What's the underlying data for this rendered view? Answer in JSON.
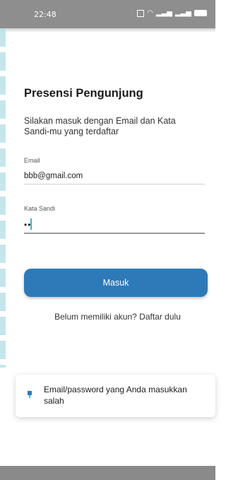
{
  "status": {
    "time": "22:48"
  },
  "title": "Presensi Pengunjung",
  "subtitle": "Silakan masuk dengan Email dan Kata Sandi-mu yang terdaftar",
  "email": {
    "label": "Email",
    "value": "bbb@gmail.com"
  },
  "password": {
    "label": "Kata Sandi",
    "masked": "••"
  },
  "login_button": "Masuk",
  "register_link": "Belum memiliki akun? Daftar dulu",
  "toast": {
    "message": "Email/password yang Anda masukkan salah"
  },
  "colors": {
    "accent": "#2e7ab8",
    "caret": "#34b7c9",
    "statusbar": "#8e8e8e"
  }
}
